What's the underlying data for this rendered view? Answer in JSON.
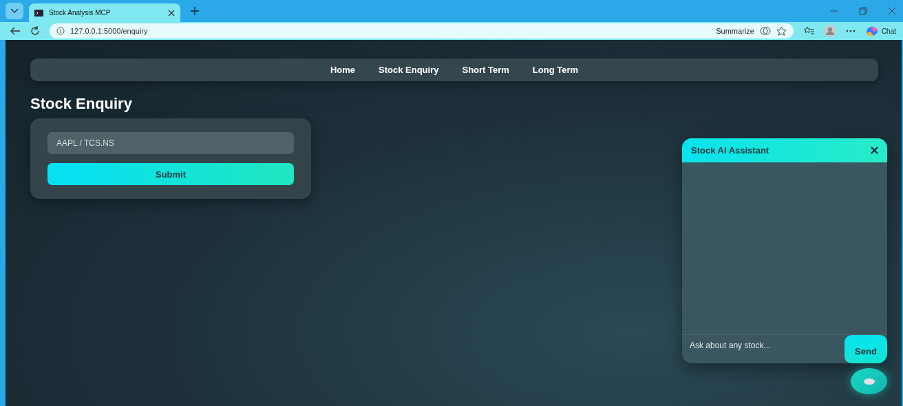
{
  "browser": {
    "tab_title": "Stock Analysis MCP",
    "url": "127.0.0.1:5000/enquiry",
    "summarize": "Summarize",
    "chat": "Chat"
  },
  "nav": [
    {
      "label": "Home"
    },
    {
      "label": "Stock Enquiry"
    },
    {
      "label": "Short Term"
    },
    {
      "label": "Long Term"
    }
  ],
  "heading": "Stock Enquiry",
  "form": {
    "placeholder": "AAPL / TCS.NS",
    "submit": "Submit"
  },
  "assistant": {
    "title": "Stock AI Assistant",
    "placeholder": "Ask about any stock...",
    "send": "Send"
  }
}
